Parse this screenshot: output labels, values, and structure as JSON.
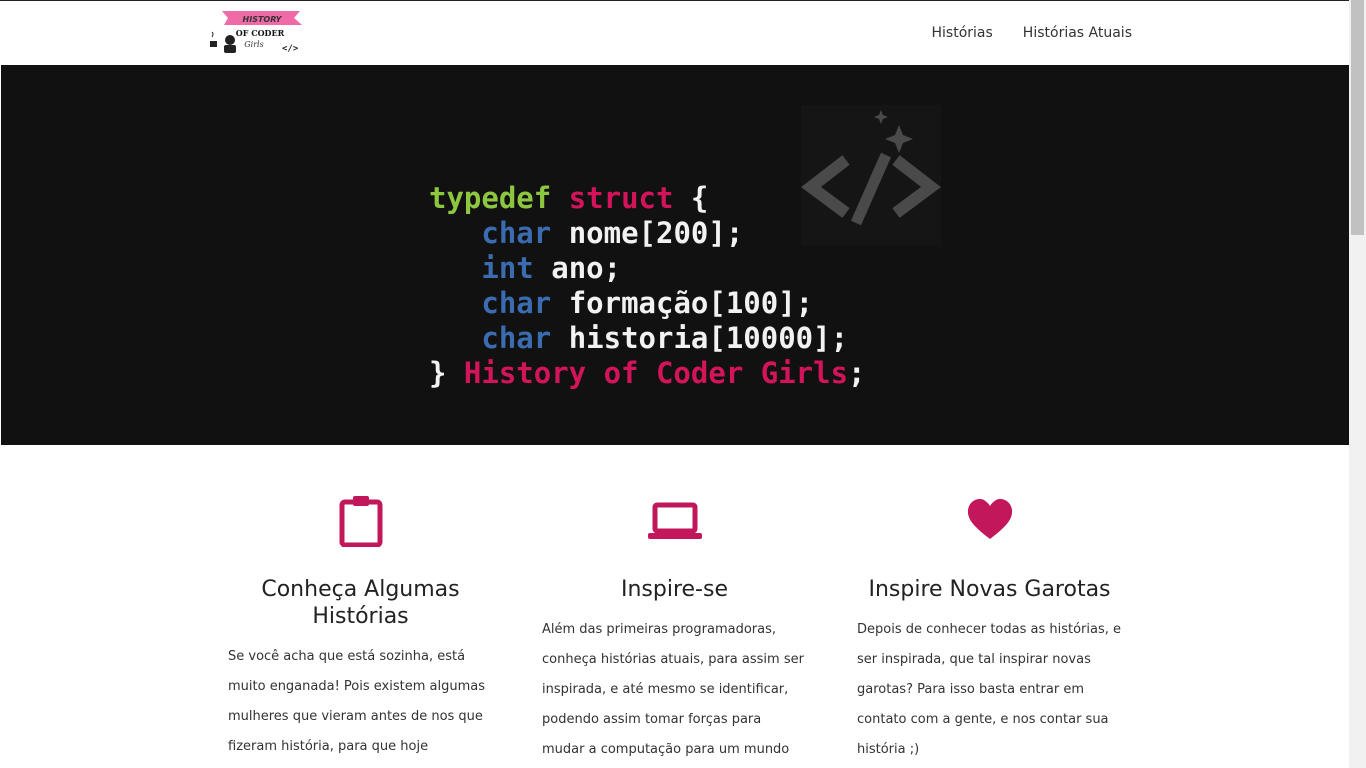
{
  "navbar": {
    "logo_text": "HISTORY OF CODER Girls",
    "links": [
      "Histórias",
      "Histórias Atuais"
    ]
  },
  "hero": {
    "code_lines": {
      "l1_kw1": "typedef",
      "l1_kw2": "struct",
      "l1_rest": " {",
      "l2_type": "char",
      "l2_rest": " nome[200];",
      "l3_type": "int",
      "l3_rest": " ano;",
      "l4_type": "char",
      "l4_rest": " formação[100];",
      "l5_type": "char",
      "l5_rest": " historia[10000];",
      "l6_start": "} ",
      "l6_name": "History of Coder Girls",
      "l6_end": ";"
    }
  },
  "features": [
    {
      "icon": "clipboard-icon",
      "title": "Conheça Algumas Histórias",
      "text": "Se você acha que está sozinha, está muito enganada! Pois existem algumas mulheres que vieram antes de nos que fizeram história, para que hoje pudessemos"
    },
    {
      "icon": "laptop-icon",
      "title": "Inspire-se",
      "text": "Além das primeiras programadoras, conheça histórias atuais, para assim ser inspirada, e até mesmo se identificar, podendo assim tomar forças para mudar a computação para um mundo mais"
    },
    {
      "icon": "heart-icon",
      "title": "Inspire Novas Garotas",
      "text": "Depois de conhecer todas as histórias, e ser inspirada, que tal inspirar novas garotas? Para isso basta entrar em contato com a gente, e nos contar sua história ;)"
    }
  ],
  "colors": {
    "accent": "#c2185b",
    "hero_bg": "#111111",
    "code_green": "#8dc63f",
    "code_pink": "#d4145a",
    "code_blue": "#3b6cb0"
  }
}
